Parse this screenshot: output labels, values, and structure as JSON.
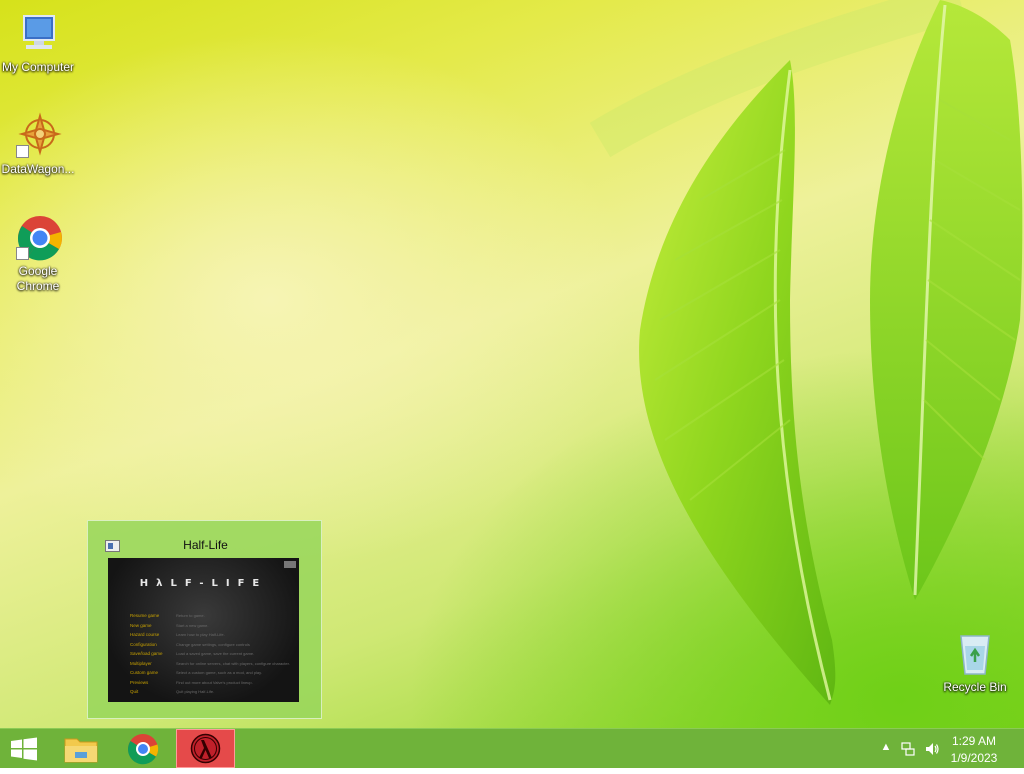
{
  "desktop": {
    "icons": [
      {
        "label": "My Computer",
        "icon": "my-computer-icon"
      },
      {
        "label": "DataWagon...",
        "icon": "datawagon-icon"
      },
      {
        "label": "Google\nChrome",
        "icon": "chrome-icon"
      },
      {
        "label": "Recycle Bin",
        "icon": "recycle-bin-icon"
      }
    ]
  },
  "thumbnail": {
    "title": "Half-Life",
    "logo_text": "HλLF-LIFE",
    "menu": [
      {
        "label": "Resume game",
        "desc": "Return to game."
      },
      {
        "label": "New game",
        "desc": "Start a new game."
      },
      {
        "label": "Hazard course",
        "desc": "Learn how to play Half-Life."
      },
      {
        "label": "Configuration",
        "desc": "Change game settings, configure controls"
      },
      {
        "label": "Save/load game",
        "desc": "Load a saved game, save the current game."
      },
      {
        "label": "Multiplayer",
        "desc": "Search for online servers, chat with players, configure character."
      },
      {
        "label": "Custom game",
        "desc": "Select a custom game, such as a mod, and play."
      },
      {
        "label": "Previews",
        "desc": "Find out more about Valve's product lineup."
      },
      {
        "label": "Quit",
        "desc": "Quit playing Half-Life."
      }
    ]
  },
  "taskbar": {
    "start_icon": "windows-start-icon",
    "apps": [
      {
        "name": "file-explorer",
        "icon": "folder-icon"
      },
      {
        "name": "google-chrome",
        "icon": "chrome-icon"
      },
      {
        "name": "half-life",
        "icon": "half-life-icon",
        "active": true
      }
    ],
    "tray": {
      "time": "1:29 AM",
      "date": "1/9/2023",
      "icons": [
        "show-hidden-icons-icon",
        "network-icon",
        "volume-icon"
      ]
    }
  },
  "colors": {
    "taskbar": "#6fb33a",
    "active_app": "#e54a4a",
    "thumb_bg": "#96d65a"
  }
}
